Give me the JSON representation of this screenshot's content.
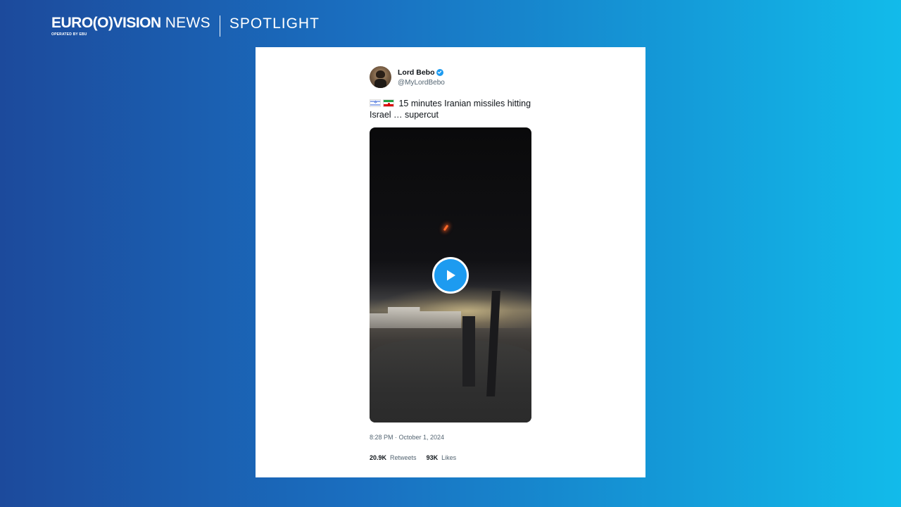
{
  "brand": {
    "logo": "EURO(O)VISION",
    "news": "NEWS",
    "operated": "OPERATED BY EBU",
    "section": "SPOTLIGHT"
  },
  "tweet": {
    "display_name": "Lord Bebo",
    "handle": "@MyLordBebo",
    "verified": true,
    "flags": [
      "israel-flag",
      "iran-flag"
    ],
    "text": "15 minutes Iranian missiles hitting Israel … supercut",
    "media": {
      "type": "video",
      "icon": "play-icon"
    },
    "timestamp": "8:28 PM · October 1, 2024",
    "retweets_count": "20.9K",
    "retweets_label": "Retweets",
    "likes_count": "93K",
    "likes_label": "Likes"
  },
  "colors": {
    "accent": "#1d9bf0",
    "background_start": "#1c4a9c",
    "background_end": "#12bbea"
  }
}
